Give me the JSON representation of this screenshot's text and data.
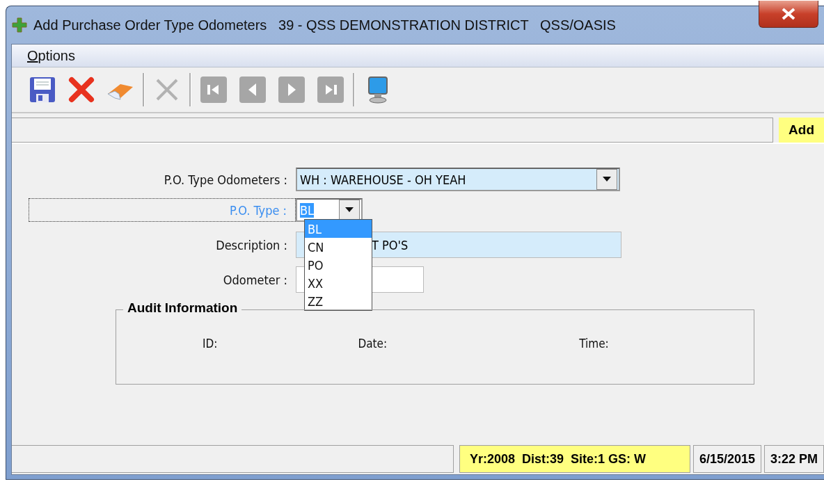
{
  "window": {
    "title": "Add Purchase Order Type Odometers   39 - QSS DEMONSTRATION DISTRICT   QSS/OASIS"
  },
  "menu": [
    {
      "label": "Options"
    }
  ],
  "toolbar": [
    {
      "kind": "save",
      "disabled": false
    },
    {
      "kind": "cancel",
      "disabled": false
    },
    {
      "kind": "clear",
      "disabled": false
    },
    {
      "kind": "separator"
    },
    {
      "kind": "delete",
      "disabled": true
    },
    {
      "kind": "separator"
    },
    {
      "kind": "first",
      "disabled": true
    },
    {
      "kind": "previous",
      "disabled": true
    },
    {
      "kind": "next",
      "disabled": true
    },
    {
      "kind": "last",
      "disabled": true
    },
    {
      "kind": "separator"
    },
    {
      "kind": "computer",
      "disabled": false
    }
  ],
  "mode": "Add",
  "fields": [
    {
      "label": "P.O. Type Odometers :",
      "kind": "combo",
      "value": "WH : WAREHOUSE - OH YEAH",
      "focused": false
    },
    {
      "label": "P.O. Type :",
      "kind": "combo",
      "value": "BL",
      "focused": true
    },
    {
      "label": "Description :",
      "kind": "text",
      "value": "T PO'S",
      "focused": false
    },
    {
      "label": "Odometer :",
      "kind": "text",
      "focused": false
    }
  ],
  "dropdown": {
    "items": [
      {
        "label": "BL",
        "selected": true
      },
      {
        "label": "CN",
        "selected": false
      },
      {
        "label": "PO",
        "selected": false
      },
      {
        "label": "XX",
        "selected": false
      },
      {
        "label": "ZZ",
        "selected": false
      }
    ]
  },
  "audit": {
    "title": "Audit Information",
    "labels": [
      "ID:",
      "Date:",
      "Time:"
    ]
  },
  "status_bar": {
    "context": "Yr:2008  Dist:39  Site:1 GS: W",
    "date": "6/15/2015",
    "time": "3:22 PM"
  }
}
